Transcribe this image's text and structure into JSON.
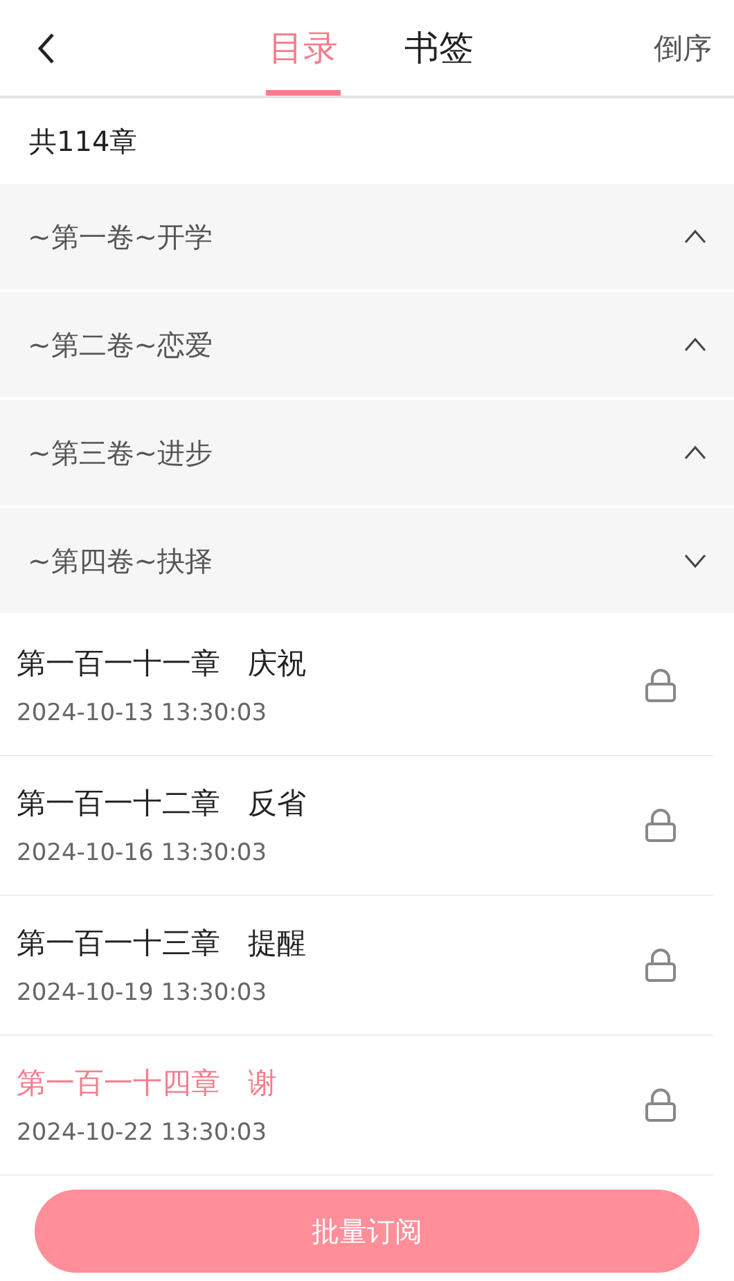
{
  "header": {
    "tabs": [
      {
        "label": "目录",
        "selected": true
      },
      {
        "label": "书签",
        "selected": false
      }
    ],
    "sort": "倒序"
  },
  "count": "共114章",
  "volumes": [
    {
      "title": "~第一卷~开学",
      "expanded": false
    },
    {
      "title": "~第二卷~恋爱",
      "expanded": false
    },
    {
      "title": "~第三卷~进步",
      "expanded": false
    },
    {
      "title": "~第四卷~抉择",
      "expanded": true,
      "chapters": [
        {
          "title": "第一百一十一章   庆祝",
          "date": "2024-10-13 13:30:03",
          "locked": true,
          "selected": false
        },
        {
          "title": "第一百一十二章   反省",
          "date": "2024-10-16 13:30:03",
          "locked": true,
          "selected": false
        },
        {
          "title": "第一百一十三章   提醒",
          "date": "2024-10-19 13:30:03",
          "locked": true,
          "selected": false
        },
        {
          "title": "第一百一十四章   谢",
          "date": "2024-10-22 13:30:03",
          "locked": true,
          "selected": true
        }
      ]
    }
  ],
  "button": "批量订阅"
}
